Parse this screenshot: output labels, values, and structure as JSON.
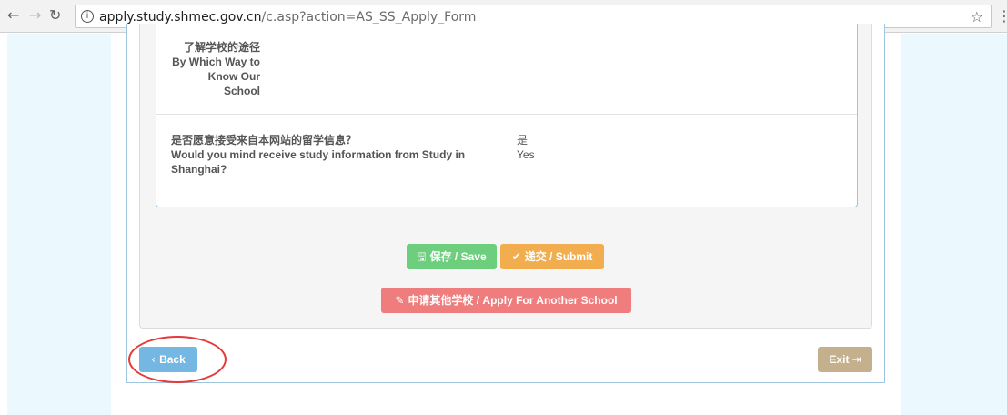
{
  "browser": {
    "url_host": "apply.study.shmec.gov.cn",
    "url_path": "/c.asp?action=AS_SS_Apply_Form",
    "back_icon": "arrow-left-icon",
    "forward_icon": "arrow-right-icon",
    "reload_icon": "reload-icon",
    "bookmark_icon": "star-icon"
  },
  "form": {
    "way_label": "了解学校的途径 By Which Way to Know Our School",
    "mind_label_cn": "是否愿意接受来自本网站的留学信息？",
    "mind_label_en": "Would you mind receive study information from Study in Shanghai?",
    "mind_value_cn": "是",
    "mind_value_en": "Yes"
  },
  "actions": {
    "save_label": "保存 / Save",
    "submit_label": "递交 / Submit",
    "another_label": "申请其他学校 / Apply For Another School",
    "back_label": "Back",
    "exit_label": "Exit"
  },
  "colors": {
    "save": "#6dcf7e",
    "submit": "#f1ad4e",
    "another": "#f07d7d",
    "back": "#74b7e2",
    "exit": "#c4b08c",
    "annotation": "#e43a3a"
  }
}
